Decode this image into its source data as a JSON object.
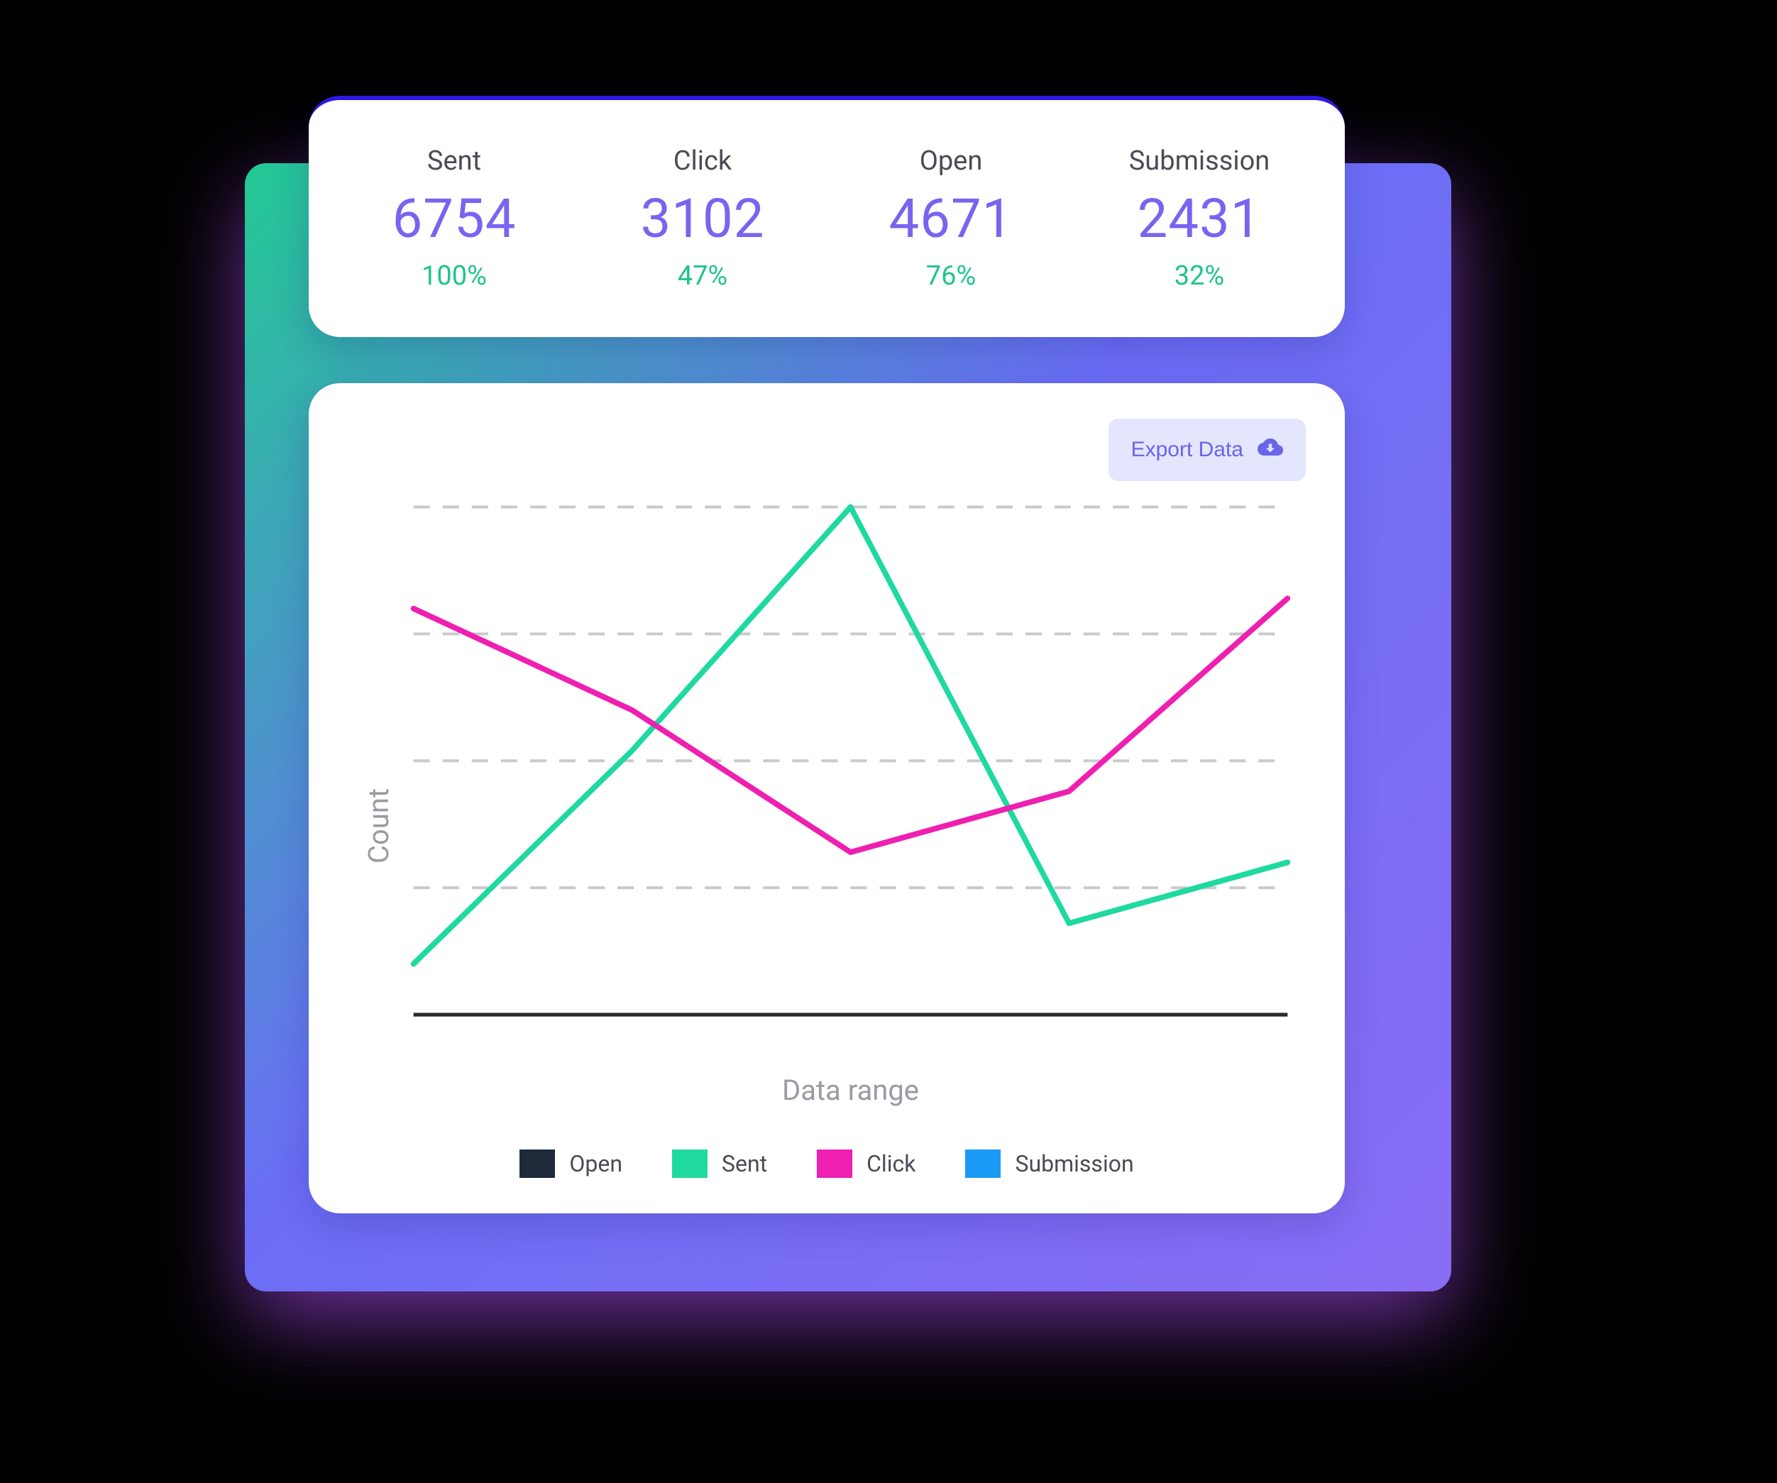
{
  "stats": [
    {
      "label": "Sent",
      "value": "6754",
      "pct": "100%"
    },
    {
      "label": "Click",
      "value": "3102",
      "pct": "47%"
    },
    {
      "label": "Open",
      "value": "4671",
      "pct": "76%"
    },
    {
      "label": "Submission",
      "value": "2431",
      "pct": "32%"
    }
  ],
  "export_label": "Export Data",
  "chart": {
    "ylabel": "Count",
    "xlabel": "Data range",
    "legend": [
      {
        "name": "Open",
        "color": "#1e2a3a"
      },
      {
        "name": "Sent",
        "color": "#1fd9a0"
      },
      {
        "name": "Click",
        "color": "#ef1fb1"
      },
      {
        "name": "Submission",
        "color": "#1a9af5"
      }
    ]
  },
  "colors": {
    "value": "#7b63f0",
    "pct": "#1ec48a",
    "grid": "#c9cace",
    "axis": "#2b2b2b"
  },
  "chart_data": {
    "type": "line",
    "xlabel": "Data range",
    "ylabel": "Count",
    "x": [
      0,
      1,
      2,
      3,
      4
    ],
    "series": [
      {
        "name": "Sent",
        "color": "#1fd9a0",
        "values": [
          10,
          52,
          100,
          18,
          30
        ]
      },
      {
        "name": "Click",
        "color": "#ef1fb1",
        "values": [
          80,
          60,
          32,
          44,
          82
        ]
      }
    ],
    "legend_only_series": [
      "Open",
      "Submission"
    ],
    "ylim": [
      0,
      100
    ],
    "grid": "dashed-horizontal"
  }
}
